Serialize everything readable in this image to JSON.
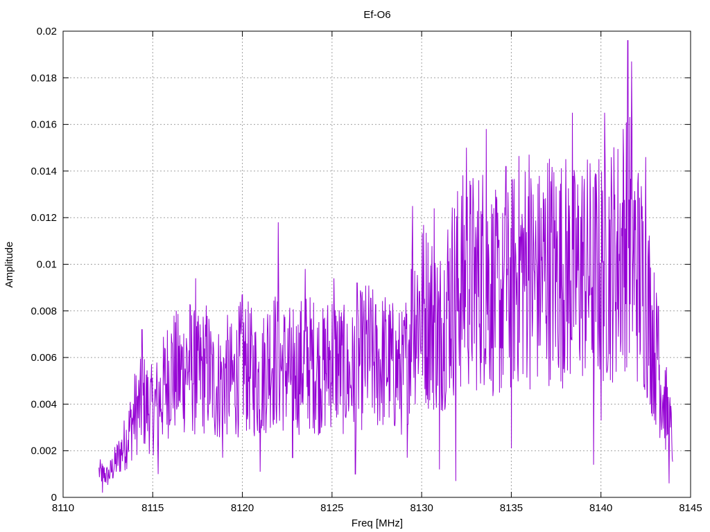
{
  "chart_data": {
    "type": "line",
    "title": "Ef-O6",
    "xlabel": "Freq [MHz]",
    "ylabel": "Amplitude",
    "xlim": [
      8110,
      8145
    ],
    "ylim": [
      0,
      0.02
    ],
    "xticks": [
      "8110",
      "8115",
      "8120",
      "8125",
      "8130",
      "8135",
      "8140",
      "8145"
    ],
    "yticks": [
      "0",
      "0.002",
      "0.004",
      "0.006",
      "0.008",
      "0.01",
      "0.012",
      "0.014",
      "0.016",
      "0.018",
      "0.02"
    ],
    "grid": true,
    "series": [
      {
        "color": "#9400d3",
        "x": [
          8112.0,
          8112.5,
          8113.0,
          8113.5,
          8114.0,
          8114.5,
          8115.0,
          8115.5,
          8116.0,
          8116.5,
          8117.0,
          8117.5,
          8118.0,
          8118.5,
          8119.0,
          8119.5,
          8120.0,
          8120.5,
          8121.0,
          8121.5,
          8122.0,
          8122.5,
          8123.0,
          8123.5,
          8124.0,
          8124.5,
          8125.0,
          8125.5,
          8126.0,
          8126.5,
          8127.0,
          8127.5,
          8128.0,
          8128.5,
          8129.0,
          8129.5,
          8130.0,
          8130.5,
          8131.0,
          8131.5,
          8132.0,
          8132.5,
          8133.0,
          8133.5,
          8134.0,
          8134.5,
          8135.0,
          8135.5,
          8136.0,
          8136.5,
          8137.0,
          8137.5,
          8138.0,
          8138.5,
          8139.0,
          8139.5,
          8140.0,
          8140.5,
          8141.0,
          8141.5,
          8142.0,
          8142.5,
          8143.0,
          8143.5,
          8144.0
        ],
        "y": [
          0.0011,
          0.0009,
          0.0016,
          0.0024,
          0.0036,
          0.0041,
          0.0037,
          0.0044,
          0.0055,
          0.0052,
          0.0058,
          0.0051,
          0.0056,
          0.0047,
          0.0053,
          0.0049,
          0.0058,
          0.0054,
          0.0049,
          0.0061,
          0.0058,
          0.0055,
          0.0054,
          0.0059,
          0.0057,
          0.0054,
          0.0061,
          0.0056,
          0.0051,
          0.0058,
          0.0062,
          0.0057,
          0.0059,
          0.0055,
          0.0053,
          0.0079,
          0.0081,
          0.0077,
          0.0071,
          0.0085,
          0.0089,
          0.0094,
          0.0092,
          0.0097,
          0.0088,
          0.0083,
          0.0091,
          0.0099,
          0.0096,
          0.0093,
          0.0101,
          0.0097,
          0.0098,
          0.0094,
          0.0099,
          0.0096,
          0.0098,
          0.0101,
          0.0104,
          0.0117,
          0.0098,
          0.0089,
          0.0064,
          0.0043,
          0.0024
        ],
        "spikes_high": [
          [
            8114.4,
            0.0072
          ],
          [
            8117.4,
            0.0094
          ],
          [
            8120.0,
            0.0087
          ],
          [
            8122.0,
            0.0118
          ],
          [
            8123.5,
            0.0098
          ],
          [
            8125.1,
            0.0094
          ],
          [
            8126.4,
            0.0092
          ],
          [
            8129.5,
            0.0125
          ],
          [
            8130.7,
            0.0124
          ],
          [
            8132.5,
            0.015
          ],
          [
            8133.6,
            0.0158
          ],
          [
            8134.7,
            0.0142
          ],
          [
            8136.0,
            0.0147
          ],
          [
            8138.4,
            0.0165
          ],
          [
            8139.6,
            0.0159
          ],
          [
            8140.2,
            0.0165
          ],
          [
            8141.5,
            0.0196
          ],
          [
            8141.7,
            0.0187
          ],
          [
            8142.5,
            0.0146
          ],
          [
            8143.2,
            0.0082
          ]
        ],
        "spikes_low": [
          [
            8112.2,
            0.0002
          ],
          [
            8115.3,
            0.001
          ],
          [
            8118.9,
            0.0017
          ],
          [
            8121.0,
            0.0011
          ],
          [
            8122.8,
            0.0017
          ],
          [
            8126.3,
            0.001
          ],
          [
            8129.2,
            0.0017
          ],
          [
            8131.0,
            0.0012
          ],
          [
            8131.9,
            0.0007
          ],
          [
            8135.0,
            0.0021
          ],
          [
            8139.6,
            0.0014
          ],
          [
            8140.0,
            0.0033
          ],
          [
            8143.8,
            0.0006
          ]
        ]
      }
    ]
  }
}
